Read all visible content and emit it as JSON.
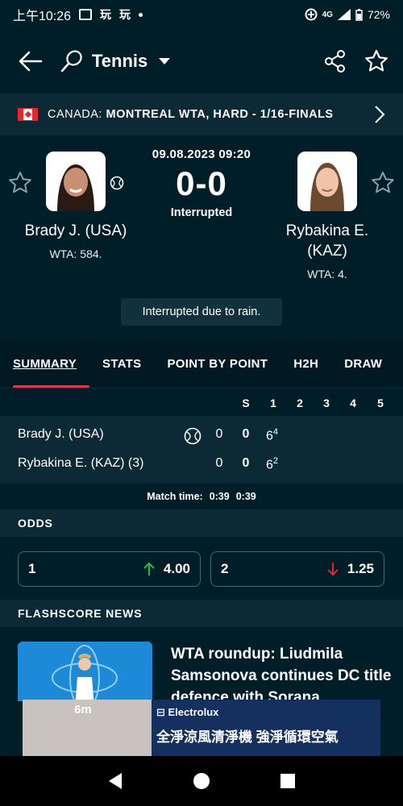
{
  "status_bar": {
    "time": "上午10:26",
    "apps": [
      "image-icon",
      "app-icon",
      "app-icon"
    ],
    "network": "4G",
    "battery": "72%"
  },
  "app_bar": {
    "sport": "Tennis"
  },
  "tournament": {
    "country": "CANADA:",
    "name": "MONTREAL WTA, HARD - 1/16-FINALS"
  },
  "match": {
    "datetime": "09.08.2023 09:20",
    "score": "0-0",
    "status": "Interrupted",
    "notice": "Interrupted due to rain.",
    "home": {
      "name": "Brady J. (USA)",
      "rank": "WTA: 584."
    },
    "away": {
      "name_line1": "Rybakina E.",
      "name_line2": "(KAZ)",
      "rank": "WTA: 4."
    }
  },
  "tabs": [
    "SUMMARY",
    "STATS",
    "POINT BY POINT",
    "H2H",
    "DRAW"
  ],
  "scoreboard": {
    "headers": [
      "S",
      "1",
      "2",
      "3",
      "4",
      "5"
    ],
    "rows": [
      {
        "name": "Brady J. (USA)",
        "points": "0",
        "sets": "0",
        "set1": "6",
        "set1_tb": "4"
      },
      {
        "name": "Rybakina E. (KAZ) (3)",
        "points": "0",
        "sets": "0",
        "set1": "6",
        "set1_tb": "2"
      }
    ],
    "match_time_label": "Match time:",
    "match_time_values": [
      "0:39",
      "0:39"
    ]
  },
  "odds": {
    "header": "ODDS",
    "items": [
      {
        "label": "1",
        "value": "4.00",
        "direction": "up",
        "color": "#2fb844"
      },
      {
        "label": "2",
        "value": "1.25",
        "direction": "down",
        "color": "#e4283a"
      }
    ]
  },
  "news": {
    "header": "FLASHSCORE NEWS",
    "headline": "WTA roundup: Liudmila Samsonova continues DC title defence with Sorana"
  },
  "ad": {
    "badge": "6m",
    "brand": "Electrolux",
    "slogan": "全淨涼風清淨機 強淨循環空氣"
  },
  "colors": {
    "background": "#001e28",
    "panel": "#0b2a36",
    "accent": "#e4354f"
  }
}
